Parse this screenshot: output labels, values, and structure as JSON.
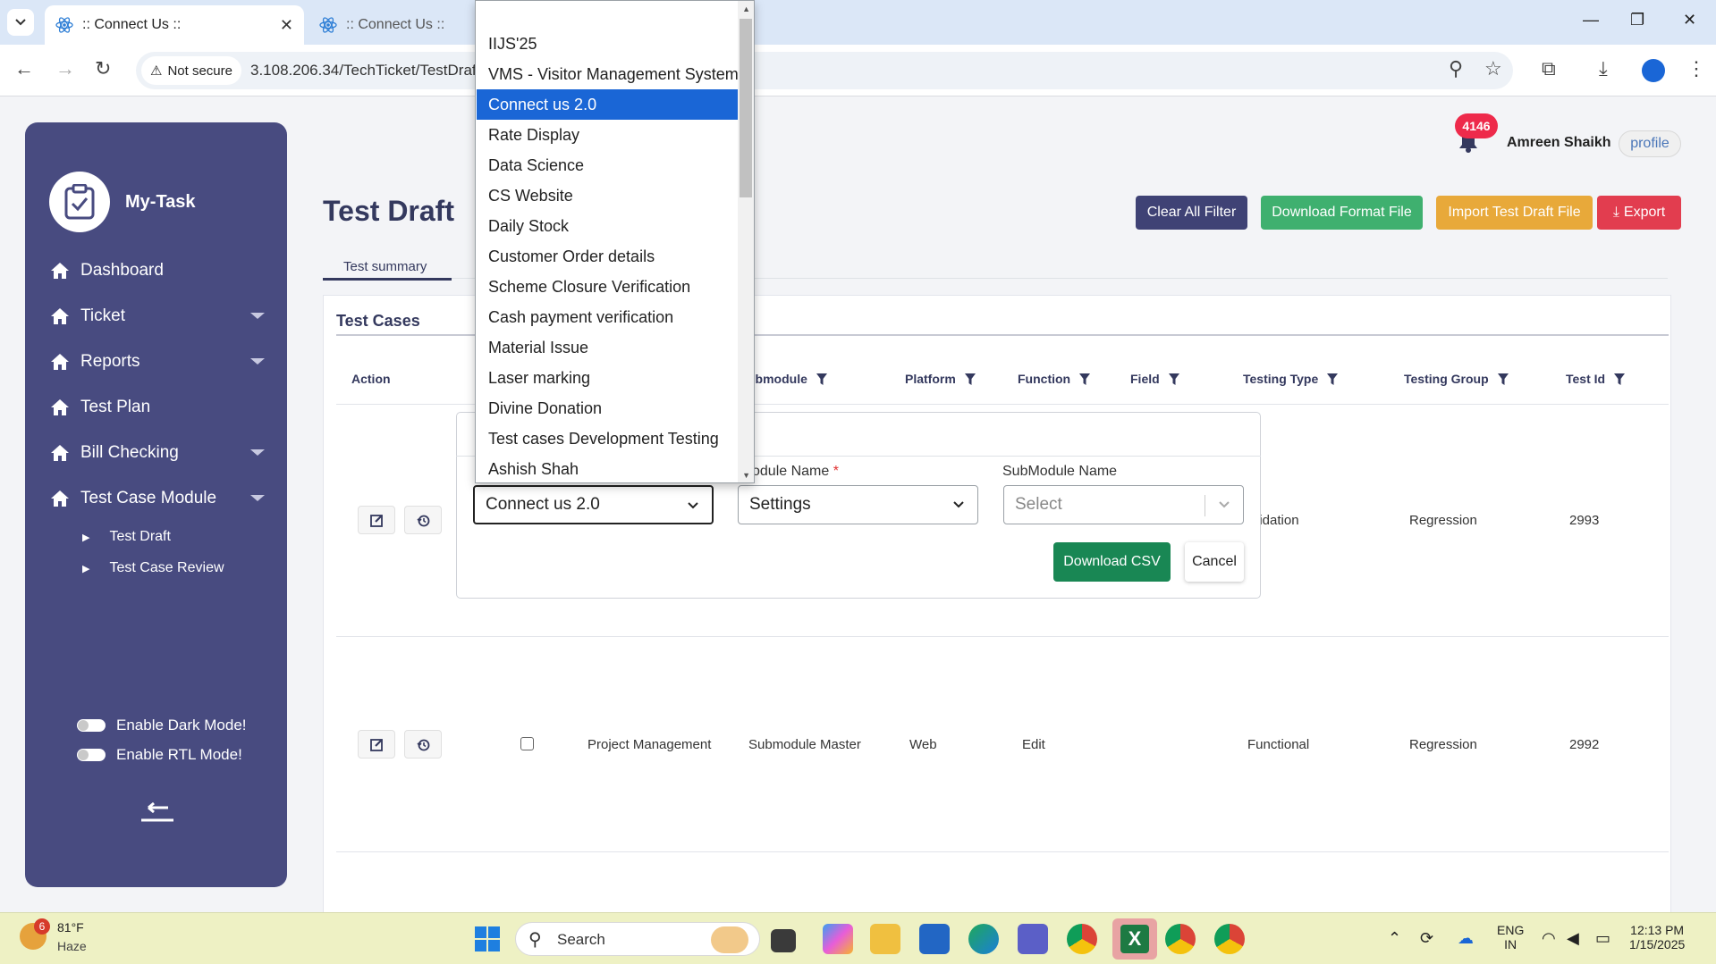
{
  "browser": {
    "tabs": [
      {
        "title": ":: Connect Us ::",
        "active": true
      },
      {
        "title": ":: Connect Us ::",
        "active": false
      }
    ],
    "security_label": "Not secure",
    "url": "3.108.206.34/TechTicket/TestDraf"
  },
  "sidebar": {
    "app_title": "My-Task",
    "items": [
      {
        "label": "Dashboard",
        "has_submenu": false
      },
      {
        "label": "Ticket",
        "has_submenu": true
      },
      {
        "label": "Reports",
        "has_submenu": true
      },
      {
        "label": "Test Plan",
        "has_submenu": false
      },
      {
        "label": "Bill Checking",
        "has_submenu": true
      },
      {
        "label": "Test Case Module",
        "has_submenu": true
      }
    ],
    "subitems": [
      "Test Draft",
      "Test Case Review"
    ],
    "toggles": [
      "Enable Dark Mode!",
      "Enable RTL Mode!"
    ]
  },
  "header": {
    "notification_count": "4146",
    "user_name": "Amreen Shaikh",
    "profile_alt": "profile",
    "page_title": "Test Draft",
    "buttons": {
      "clear_filter": "Clear All Filter",
      "download_format": "Download Format File",
      "import": "Import Test Draft File",
      "export": "Export"
    },
    "colors": {
      "clear": "#3f4275",
      "download": "#3fb06f",
      "import": "#e8a93a",
      "export": "#e23d4f"
    }
  },
  "tabs": {
    "active": "Test summary"
  },
  "table": {
    "title": "Test Cases",
    "columns": [
      "Action",
      "ubmodule",
      "Platform",
      "Function",
      "Field",
      "Testing Type",
      "Testing Group",
      "Test Id"
    ],
    "rows": [
      {
        "testing_type": "lidation",
        "testing_group": "Regression",
        "test_id": "2993"
      },
      {
        "project": "Project Management",
        "submodule": "Submodule Master",
        "platform": "Web",
        "function": "Edit",
        "field": "",
        "testing_type": "Functional",
        "testing_group": "Regression",
        "test_id": "2992"
      }
    ]
  },
  "modal": {
    "module_label": "odule Name",
    "required_mark": "*",
    "submodule_label": "SubModule Name",
    "project_value": "Connect us 2.0",
    "module_value": "Settings",
    "submodule_placeholder": "Select",
    "download_button": "Download CSV",
    "cancel_button": "Cancel"
  },
  "dropdown": {
    "options": [
      "IIJS'25",
      "VMS - Visitor Management System",
      "Connect us 2.0",
      "Rate Display",
      "Data Science",
      "CS Website",
      "Daily Stock",
      "Customer Order details",
      "Scheme Closure Verification",
      "Cash payment verification",
      "Material Issue",
      "Laser marking",
      "Divine Donation",
      "Test cases Development Testing",
      "Ashish Shah"
    ],
    "selected": "Connect us 2.0"
  },
  "taskbar": {
    "weather_badge": "6",
    "temperature": "81°F",
    "condition": "Haze",
    "search_label": "Search",
    "lang_line1": "ENG",
    "lang_line2": "IN",
    "time": "12:13 PM",
    "date": "1/15/2025"
  }
}
